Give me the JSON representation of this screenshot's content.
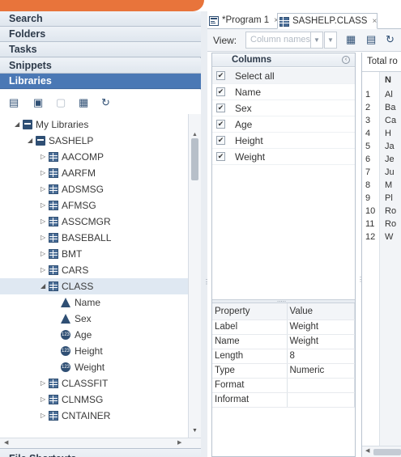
{
  "nav": {
    "sections": [
      "Search",
      "Folders",
      "Tasks",
      "Snippets",
      "Libraries"
    ],
    "active": "Libraries",
    "file_shortcuts": "File Shortcuts"
  },
  "library_toolbar": {
    "icons": [
      "new-library-icon",
      "properties-icon",
      "delete-icon",
      "view-icon",
      "refresh-icon"
    ]
  },
  "tree": {
    "root": "My Libraries",
    "library": "SASHELP",
    "tables_before": [
      "AACOMP",
      "AARFM",
      "ADSMSG",
      "AFMSG",
      "ASSCMGR",
      "BASEBALL",
      "BMT",
      "CARS"
    ],
    "selected_table": "CLASS",
    "columns": [
      {
        "name": "Name",
        "type": "char"
      },
      {
        "name": "Sex",
        "type": "char"
      },
      {
        "name": "Age",
        "type": "num"
      },
      {
        "name": "Height",
        "type": "num"
      },
      {
        "name": "Weight",
        "type": "num"
      }
    ],
    "tables_after": [
      "CLASSFIT",
      "CLNMSG",
      "CNTAINER"
    ]
  },
  "tabs": [
    {
      "label": "*Program 1",
      "close": "×"
    },
    {
      "label": "SASHELP.CLASS",
      "close": "×"
    }
  ],
  "toolbar": {
    "view_label": "View:",
    "view_placeholder": "Column names"
  },
  "columns_panel": {
    "title": "Columns",
    "select_all": "Select all",
    "items": [
      "Name",
      "Sex",
      "Age",
      "Height",
      "Weight"
    ]
  },
  "properties": {
    "headers": [
      "Property",
      "Value"
    ],
    "rows": [
      [
        "Label",
        "Weight"
      ],
      [
        "Name",
        "Weight"
      ],
      [
        "Length",
        "8"
      ],
      [
        "Type",
        "Numeric"
      ],
      [
        "Format",
        ""
      ],
      [
        "Informat",
        ""
      ]
    ]
  },
  "data_view": {
    "total_label": "Total ro",
    "header_letter": "N",
    "rows": [
      [
        "1",
        "Al"
      ],
      [
        "2",
        "Ba"
      ],
      [
        "3",
        "Ca"
      ],
      [
        "4",
        "H"
      ],
      [
        "5",
        "Ja"
      ],
      [
        "6",
        "Je"
      ],
      [
        "7",
        "Ju"
      ],
      [
        "8",
        "M"
      ],
      [
        "9",
        "Pl"
      ],
      [
        "10",
        "Ro"
      ],
      [
        "11",
        "Ro"
      ],
      [
        "12",
        "W"
      ]
    ]
  },
  "colors": {
    "accent_orange": "#e8743b",
    "active_nav": "#4a78b5",
    "icon_blue": "#2f4f74"
  }
}
